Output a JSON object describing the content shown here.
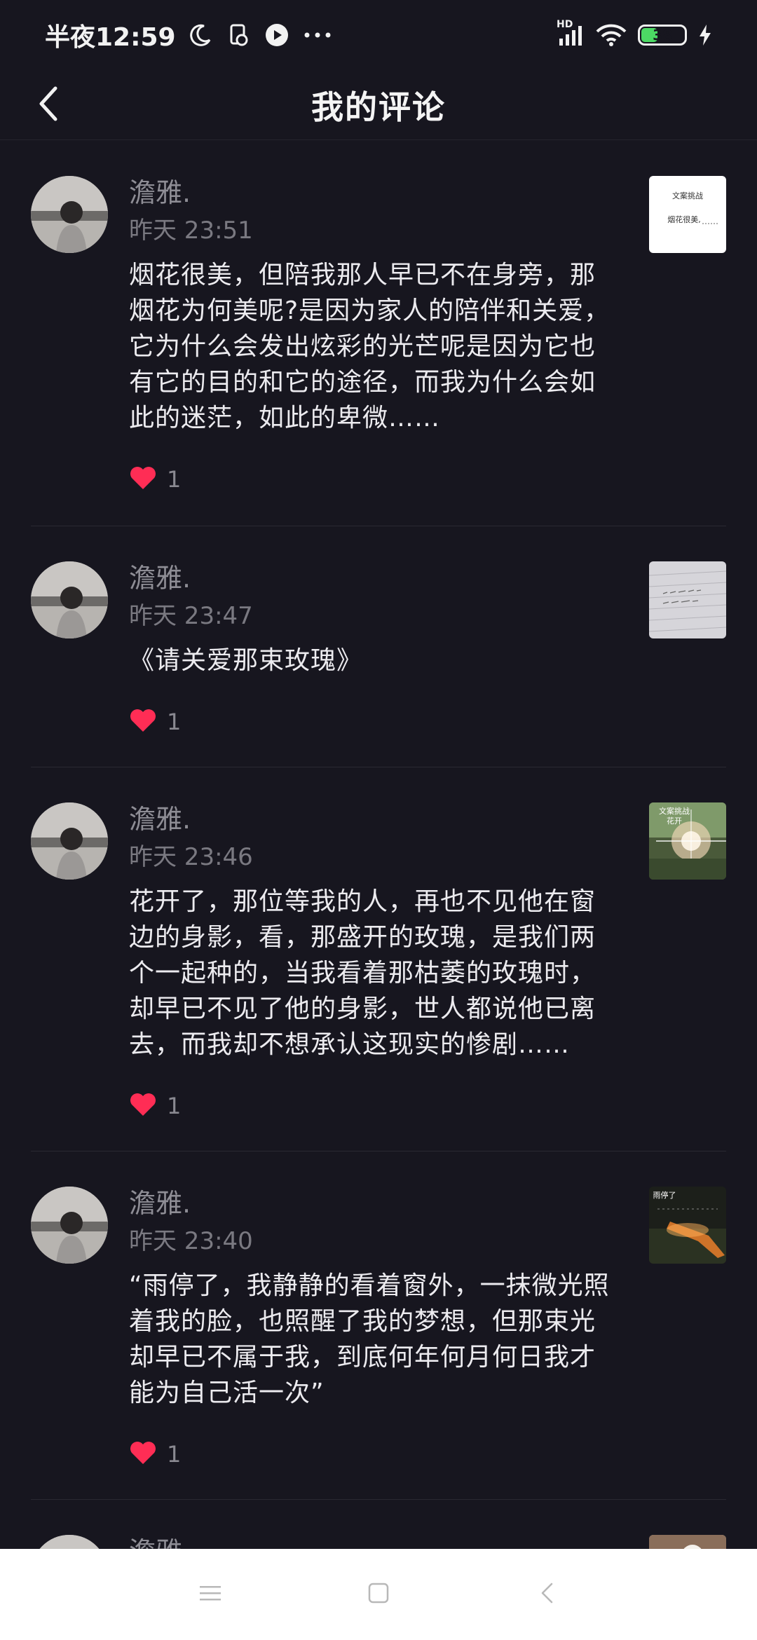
{
  "status_bar": {
    "time": "半夜12:59",
    "battery_level": "38",
    "network": "HD"
  },
  "header": {
    "title": "我的评论"
  },
  "comments": [
    {
      "username": "澹雅.",
      "time": "昨天 23:51",
      "text": "烟花很美，但陪我那人早已不在身旁，那烟花为何美呢?是因为家人的陪伴和关爱，它为什么会发出炫彩的光芒呢是因为它也有它的目的和它的途径，而我为什么会如此的迷茫，如此的卑微……",
      "likes": "1"
    },
    {
      "username": "澹雅.",
      "time": "昨天 23:47",
      "text": "《请关爱那束玫瑰》",
      "likes": "1"
    },
    {
      "username": "澹雅.",
      "time": "昨天 23:46",
      "text": "花开了，那位等我的人，再也不见他在窗边的身影，看，那盛开的玫瑰，是我们两个一起种的，当我看着那枯萎的玫瑰时，却早已不见了他的身影，世人都说他已离去，而我却不想承认这现实的惨剧……",
      "likes": "1"
    },
    {
      "username": "澹雅.",
      "time": "昨天 23:40",
      "text": "“雨停了，我静静的看着窗外，一抹微光照着我的脸，也照醒了我的梦想，但那束光却早已不属于我，到底何年何月何日我才能为自己活一次”",
      "likes": "1"
    },
    {
      "username": "澹雅.",
      "time": "",
      "text": "",
      "likes": ""
    }
  ],
  "thumb_texts": {
    "t1_line1": "文案挑战",
    "t1_line2": "烟花很美,",
    "t3_line1": "文案挑战",
    "t3_line2": "花开",
    "t4_line1": "雨停了"
  },
  "colors": {
    "background": "#17161f",
    "heart": "#ff2d55",
    "battery": "#4cd964"
  },
  "icons": {
    "back": "chevron-left-icon",
    "like": "heart-icon",
    "nav_menu": "menu-icon",
    "nav_home": "square-icon",
    "nav_back": "triangle-back-icon"
  }
}
